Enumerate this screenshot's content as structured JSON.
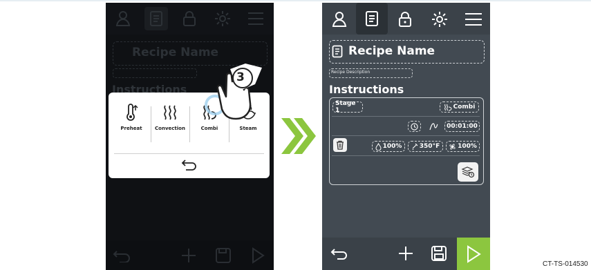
{
  "left_screen": {
    "title": "Recipe Name",
    "description_label": "Recipe Description",
    "instructions_heading": "Instructions",
    "nav_icons": [
      "user-icon",
      "recipe-book-icon",
      "lock-icon",
      "brightness-icon",
      "menu-icon"
    ],
    "popup": {
      "options": [
        {
          "label": "Preheat",
          "icon": "thermometer-icon"
        },
        {
          "label": "Convection",
          "icon": "convection-waves-icon"
        },
        {
          "label": "Combi",
          "icon": "combi-icon"
        },
        {
          "label": "Steam",
          "icon": "steam-icon"
        }
      ],
      "back_icon": "back-arrow-icon"
    },
    "step_marker": "3"
  },
  "right_screen": {
    "title": "Recipe Name",
    "description_label": "Recipe Description",
    "instructions_heading": "Instructions",
    "stage": {
      "name": "Stage 1",
      "mode": "Combi",
      "time": "00:01:00",
      "humidity": "100%",
      "temperature": "350°F",
      "fan": "100%"
    }
  },
  "colors": {
    "accent_green": "#8cc63f",
    "dark_screen": "#424a52",
    "dim_screen": "#0f1114"
  },
  "figure_code": "CT-TS-014530"
}
